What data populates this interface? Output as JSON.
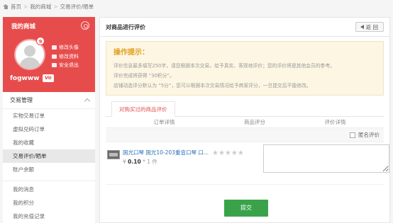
{
  "breadcrumb": [
    "首页",
    "我的商城",
    "交易评价/晒单"
  ],
  "profile": {
    "title": "我的商城",
    "badge": "9",
    "links": [
      "修改头像",
      "修改资料",
      "安全退出"
    ],
    "username": "fogwww",
    "vip_label": "Vo"
  },
  "menu": {
    "section": "交易管理",
    "items": [
      "实物交易订单",
      "虚拟兑码订单",
      "我的收藏",
      "交易评价/晒单",
      "账户余额"
    ],
    "active_index": 3,
    "items2": [
      "我的消息",
      "我的积分",
      "我的充值记录"
    ]
  },
  "main": {
    "title": "对商品进行评价",
    "back_label": "返 回",
    "tip_title": "操作提示：",
    "tip_lines": [
      "评价信息最多填写250字，请您根据本次交易，给予真实、客观地评价；您的评价将是其他会员的参考。",
      "评价完成将获得 “30积分”。",
      "店铺动态评分默认为 “5分”，您可以根据本次交易情况给予商家评分，一旦提交后不能修改。"
    ],
    "tab_label": "对购买过的商品评价",
    "columns": [
      "订单详情",
      "商品评分",
      "评价详情"
    ],
    "anon_label": "匿名评价",
    "goods": {
      "name": "国光口琴 国光10-203重音口琴 口...",
      "currency": "¥",
      "price": "0.10",
      "qty_text": "* 1 件",
      "stars": "★★★★★"
    },
    "submit_label": "提交"
  }
}
